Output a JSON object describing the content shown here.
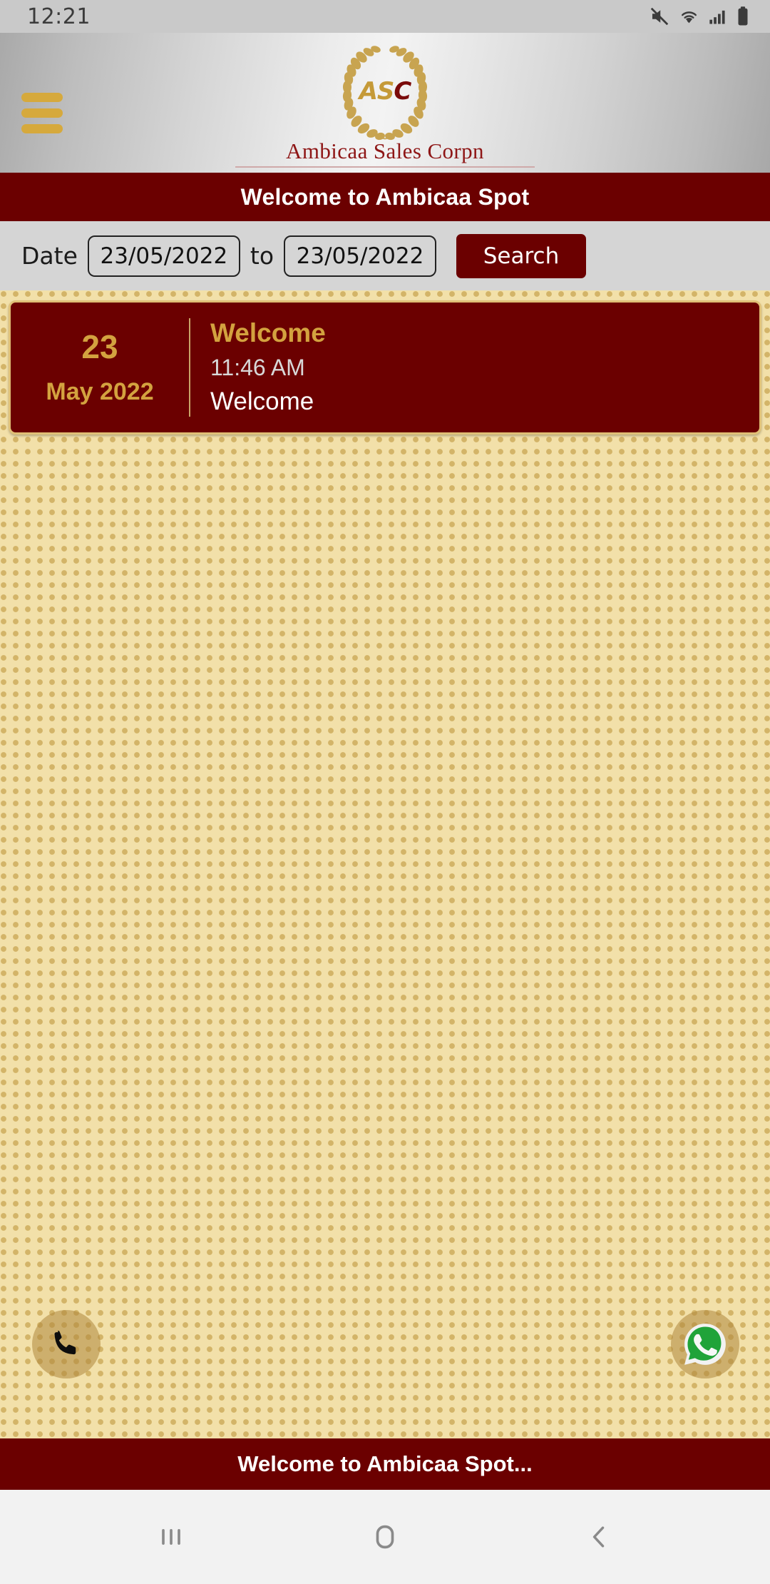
{
  "status_bar": {
    "time": "12:21",
    "icons": [
      "mute-icon",
      "wifi-icon",
      "signal-icon",
      "battery-icon"
    ]
  },
  "header": {
    "menu_icon": "hamburger-menu-icon",
    "logo_mark": "ASC",
    "logo_mark_gold": "AS",
    "logo_mark_red": "C",
    "company_name": "Ambicaa Sales Corpn",
    "wreath_icon": "laurel-wreath-icon"
  },
  "title_bar": {
    "title": "Welcome to Ambicaa Spot"
  },
  "search": {
    "date_label": "Date",
    "from_date": "23/05/2022",
    "to_label": "to",
    "to_date": "23/05/2022",
    "search_label": "Search"
  },
  "entries": [
    {
      "day": "23",
      "month_year": "May 2022",
      "title": "Welcome",
      "time": "11:46 AM",
      "description": "Welcome"
    }
  ],
  "fabs": {
    "call_icon": "phone-icon",
    "whatsapp_icon": "whatsapp-icon"
  },
  "footer": {
    "text": "Welcome to Ambicaa Spot..."
  },
  "nav_bar": {
    "recents": "recents-icon",
    "home": "home-icon",
    "back": "back-icon"
  },
  "colors": {
    "maroon": "#6b0000",
    "gold": "#d3a23f",
    "pattern_bg": "#f2e0a9",
    "pattern_dot": "#d3b468",
    "whatsapp_green": "#25a34a"
  }
}
